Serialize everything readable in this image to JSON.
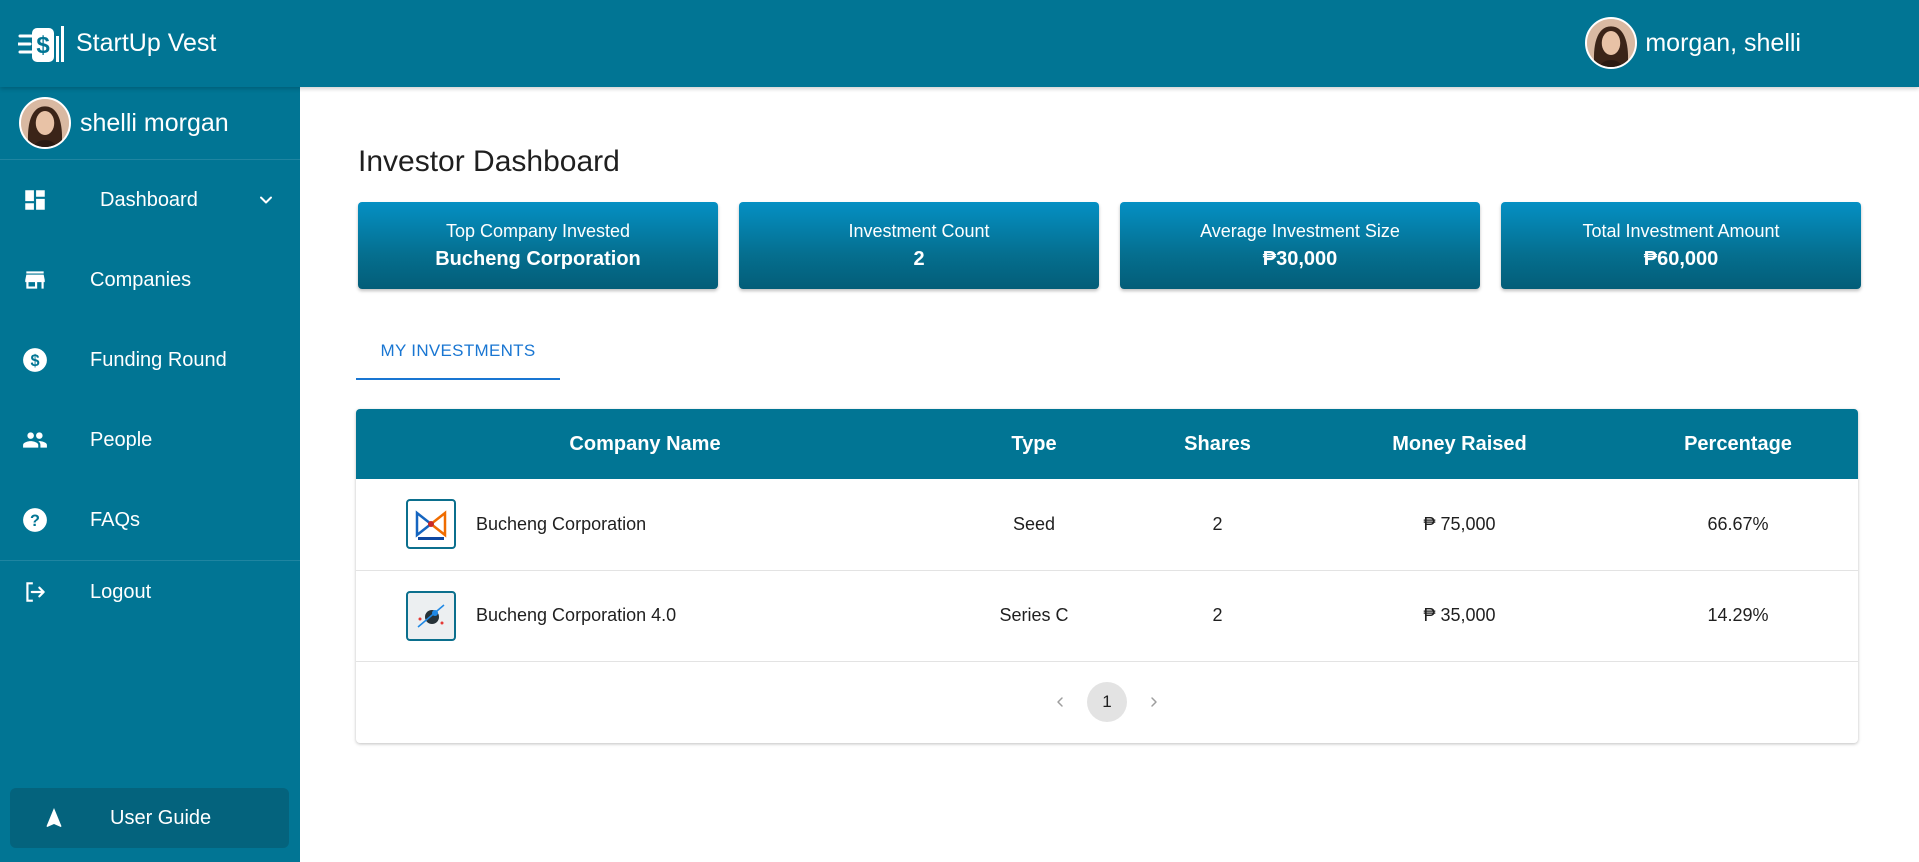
{
  "app": {
    "brand_name": "StartUp Vest",
    "brand_icon": "dollar-logo-icon",
    "user_display": "morgan, shelli"
  },
  "sidebar": {
    "user_name": "shelli morgan",
    "items": [
      {
        "label": "Dashboard",
        "icon": "dashboard-icon",
        "expandable": true
      },
      {
        "label": "Companies",
        "icon": "store-icon"
      },
      {
        "label": "Funding Round",
        "icon": "dollar-circle-icon"
      },
      {
        "label": "People",
        "icon": "people-icon"
      },
      {
        "label": "FAQs",
        "icon": "help-circle-icon"
      },
      {
        "label": "Logout",
        "icon": "logout-icon"
      }
    ],
    "guide_label": "User Guide",
    "guide_icon": "navigation-arrow-icon"
  },
  "main": {
    "title": "Investor Dashboard",
    "cards": [
      {
        "label": "Top Company Invested",
        "value": "Bucheng Corporation"
      },
      {
        "label": "Investment Count",
        "value": "2"
      },
      {
        "label": "Average Investment Size",
        "value": "₱30,000"
      },
      {
        "label": "Total Investment Amount",
        "value": "₱60,000"
      }
    ],
    "tab_label": "MY INVESTMENTS",
    "table": {
      "headers": [
        "Company Name",
        "Type",
        "Shares",
        "Money Raised",
        "Percentage"
      ],
      "rows": [
        {
          "company": "Bucheng Corporation",
          "type": "Seed",
          "shares": "2",
          "money_raised": "₱ 75,000",
          "percentage": "66.67%"
        },
        {
          "company": "Bucheng Corporation 4.0",
          "type": "Series C",
          "shares": "2",
          "money_raised": "₱ 35,000",
          "percentage": "14.29%"
        }
      ]
    },
    "pagination": {
      "current_page": "1"
    }
  },
  "colors": {
    "primary": "#017594",
    "card_top": "#0590c4",
    "card_bottom": "#035d78",
    "tab_accent": "#1976d2"
  }
}
